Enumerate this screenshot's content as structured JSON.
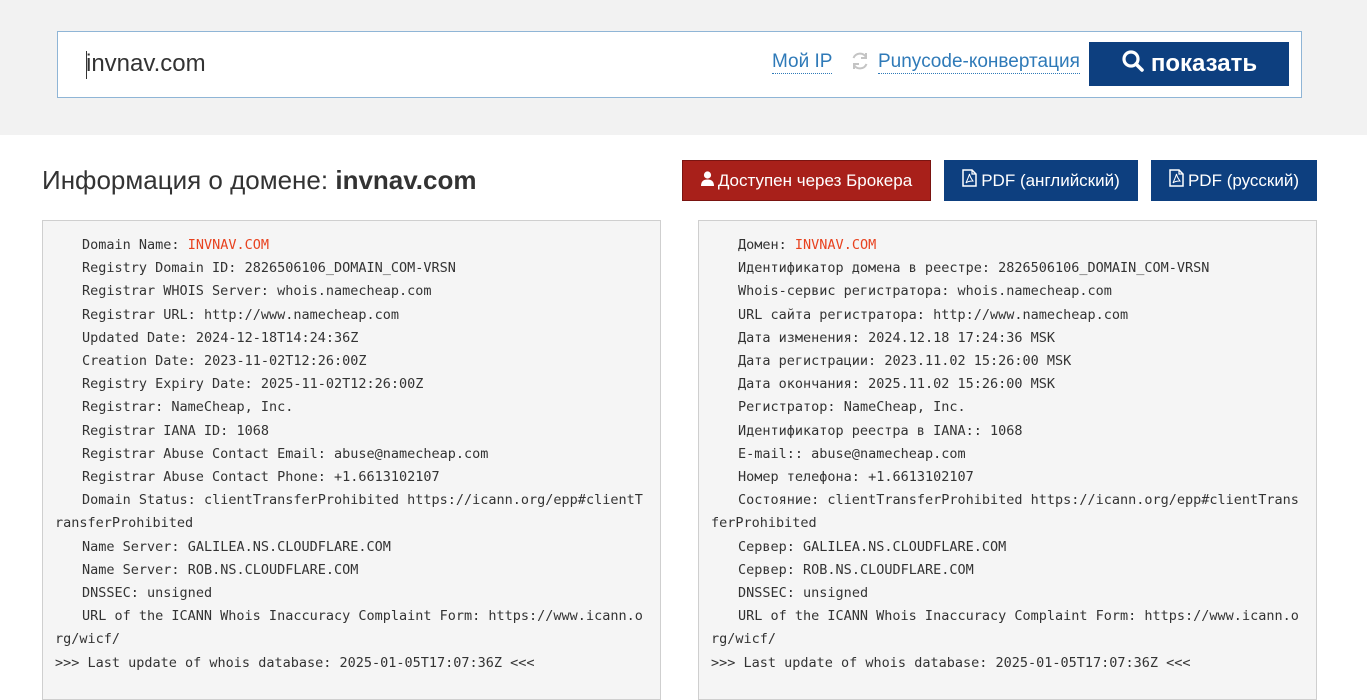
{
  "search": {
    "value": "invnav.com",
    "my_ip_label": "Мой IP",
    "punycode_label": "Punycode-конвертация",
    "show_button_label": "показать"
  },
  "title": {
    "prefix": "Информация о домене:",
    "domain": "invnav.com"
  },
  "buttons": {
    "broker": "Доступен через Брокера",
    "pdf_en": "PDF (английский)",
    "pdf_ru": "PDF (русский)"
  },
  "colors": {
    "brand_blue": "#0d3f7f",
    "broker_red": "#a8201a",
    "domain_highlight": "#e8421f",
    "link_blue": "#2f7ab8"
  },
  "whois_en": [
    {
      "label": "Domain Name:",
      "value": "INVNAV.COM",
      "highlight": true
    },
    {
      "label": "Registry Domain ID:",
      "value": "2826506106_DOMAIN_COM-VRSN"
    },
    {
      "label": "Registrar WHOIS Server:",
      "value": "whois.namecheap.com"
    },
    {
      "label": "Registrar URL:",
      "value": "http://www.namecheap.com"
    },
    {
      "label": "Updated Date:",
      "value": "2024-12-18T14:24:36Z"
    },
    {
      "label": "Creation Date:",
      "value": "2023-11-02T12:26:00Z"
    },
    {
      "label": "Registry Expiry Date:",
      "value": "2025-11-02T12:26:00Z"
    },
    {
      "label": "Registrar:",
      "value": "NameCheap, Inc."
    },
    {
      "label": "Registrar IANA ID:",
      "value": "1068"
    },
    {
      "label": "Registrar Abuse Contact Email:",
      "value": "abuse@namecheap.com"
    },
    {
      "label": "Registrar Abuse Contact Phone:",
      "value": "+1.6613102107"
    },
    {
      "label": "Domain Status:",
      "value": "clientTransferProhibited https://icann.org/epp#clientTransferProhibited"
    },
    {
      "label": "Name Server:",
      "value": "GALILEA.NS.CLOUDFLARE.COM"
    },
    {
      "label": "Name Server:",
      "value": "ROB.NS.CLOUDFLARE.COM"
    },
    {
      "label": "DNSSEC:",
      "value": "unsigned"
    },
    {
      "label": "URL of the ICANN Whois Inaccuracy Complaint Form:",
      "value": "https://www.icann.org/wicf/"
    },
    {
      "label": ">>> Last update of whois database:",
      "value": "2025-01-05T17:07:36Z <<<",
      "no_indent": true
    }
  ],
  "whois_ru": [
    {
      "label": "Домен:",
      "value": "INVNAV.COM",
      "highlight": true
    },
    {
      "label": "Идентификатор домена в реестре:",
      "value": "2826506106_DOMAIN_COM-VRSN"
    },
    {
      "label": "Whois-сервис регистратора:",
      "value": "whois.namecheap.com"
    },
    {
      "label": "URL сайта регистратора:",
      "value": "http://www.namecheap.com"
    },
    {
      "label": "Дата изменения:",
      "value": "2024.12.18 17:24:36 MSK"
    },
    {
      "label": "Дата регистрации:",
      "value": "2023.11.02 15:26:00 MSK"
    },
    {
      "label": "Дата окончания:",
      "value": "2025.11.02 15:26:00 MSK"
    },
    {
      "label": "Регистратор:",
      "value": "NameCheap, Inc."
    },
    {
      "label": "Идентификатор реестра в IANA::",
      "value": "1068"
    },
    {
      "label": "E-mail::",
      "value": "abuse@namecheap.com"
    },
    {
      "label": "Номер телефона:",
      "value": "+1.6613102107"
    },
    {
      "label": "Состояние:",
      "value": "clientTransferProhibited https://icann.org/epp#clientTransferProhibited"
    },
    {
      "label": "Сервер:",
      "value": "GALILEA.NS.CLOUDFLARE.COM"
    },
    {
      "label": "Сервер:",
      "value": "ROB.NS.CLOUDFLARE.COM"
    },
    {
      "label": "DNSSEC:",
      "value": "unsigned"
    },
    {
      "label": "URL of the ICANN Whois Inaccuracy Complaint Form:",
      "value": "https://www.icann.org/wicf/"
    },
    {
      "label": ">>> Last update of whois database:",
      "value": "2025-01-05T17:07:36Z <<<",
      "no_indent": true
    }
  ]
}
